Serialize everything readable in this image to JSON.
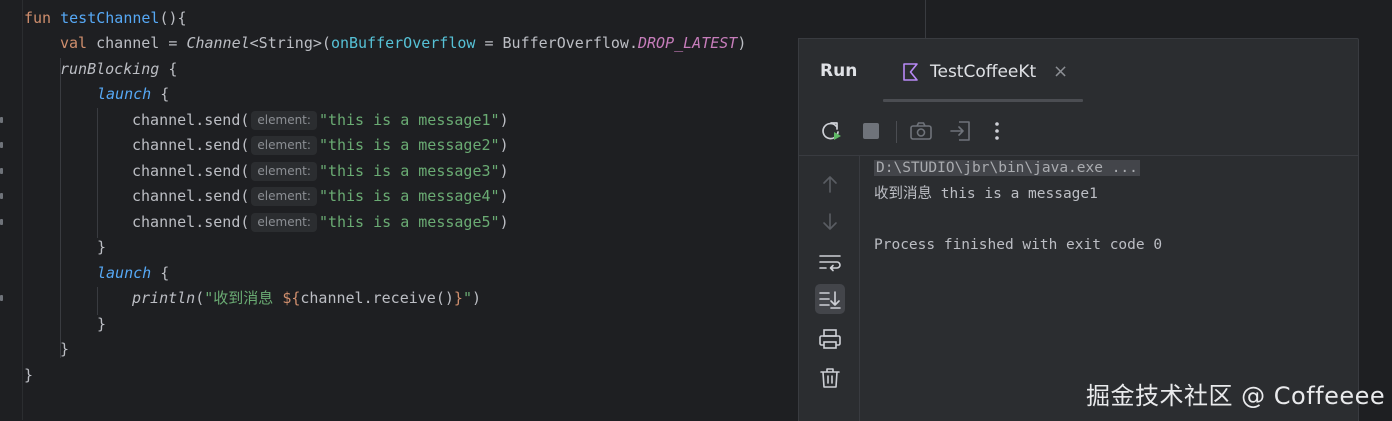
{
  "editor": {
    "code": {
      "l1": {
        "kw": "fun",
        "name": "testChannel",
        "rest": "(){"
      },
      "l2": {
        "kw": "val",
        "var": " channel = ",
        "type": "Channel",
        "generic": "<String>(",
        "param": "onBufferOverflow",
        "eq": " = ",
        "cls": "BufferOverflow.",
        "const": "DROP_LATEST",
        "close": ")"
      },
      "l3": {
        "fn": "runBlocking",
        "rest": " {"
      },
      "l4": {
        "fn": "launch",
        "rest": " {"
      },
      "send_prefix": "channel.send(",
      "hint": "element:",
      "sends": [
        "\"this is a message1\"",
        "\"this is a message2\"",
        "\"this is a message3\"",
        "\"this is a message4\"",
        "\"this is a message5\""
      ],
      "send_suffix": ")",
      "l10": "}",
      "l11": {
        "fn": "launch",
        "rest": " {"
      },
      "l12": {
        "fn": "println",
        "open": "(",
        "str": "\"收到消息 ",
        "tmpl_open": "${",
        "expr": "channel.receive()",
        "tmpl_close": "}",
        "str_end": "\"",
        "close": ")"
      },
      "l13": "}",
      "l14": "}",
      "l15": "}"
    }
  },
  "run": {
    "title": "Run",
    "tab_label": "TestCoffeeKt",
    "tab_close": "×",
    "console": [
      "D:\\STUDIO\\jbr\\bin\\java.exe ...",
      "收到消息 this is a message1",
      "",
      "Process finished with exit code 0"
    ],
    "icons": {
      "toolbar": [
        "rerun-icon",
        "stop-icon",
        "camera-icon",
        "exit-icon",
        "more-vertical-icon"
      ],
      "side": [
        "arrow-up-icon",
        "arrow-down-icon",
        "soft-wrap-icon",
        "scroll-to-end-icon",
        "print-icon",
        "trash-icon"
      ]
    },
    "colors": {
      "accent_kotlin": "#b889f6",
      "string": "#6aab73",
      "keyword": "#cf8e6d"
    }
  },
  "watermark": "掘金技术社区 @ Coffeeee"
}
